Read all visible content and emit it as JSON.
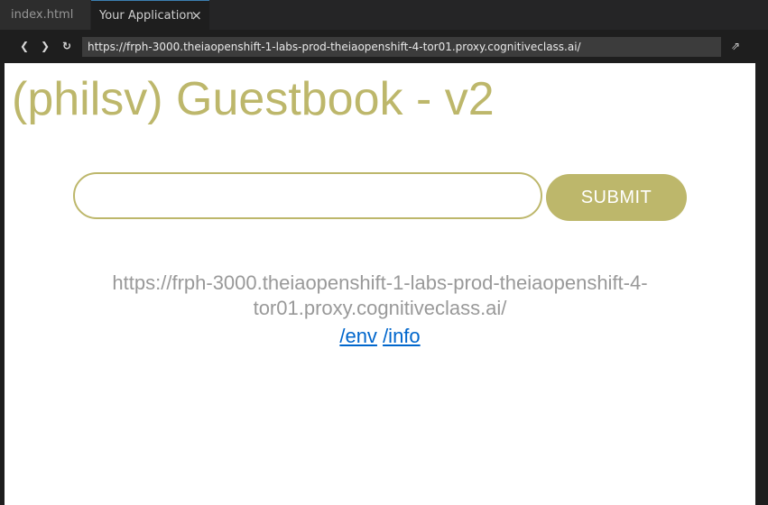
{
  "tabs": [
    {
      "label": "index.html"
    },
    {
      "label": "Your Application",
      "close_glyph": "×"
    }
  ],
  "toolbar": {
    "back_glyph": "❮",
    "forward_glyph": "❯",
    "reload_glyph": "↻",
    "url": "https://frph-3000.theiaopenshift-1-labs-prod-theiaopenshift-4-tor01.proxy.cognitiveclass.ai/",
    "external_glyph": "⇗"
  },
  "page": {
    "title": "(philsv) Guestbook - v2",
    "entry_value": "",
    "submit_label": "SUBMIT",
    "host_info": "https://frph-3000.theiaopenshift-1-labs-prod-theiaopenshift-4-tor01.proxy.cognitiveclass.ai/",
    "env_link": "/env",
    "info_link": "/info"
  },
  "colors": {
    "accent": "#bdb76b",
    "link": "#0066cc",
    "muted_text": "#999999"
  }
}
